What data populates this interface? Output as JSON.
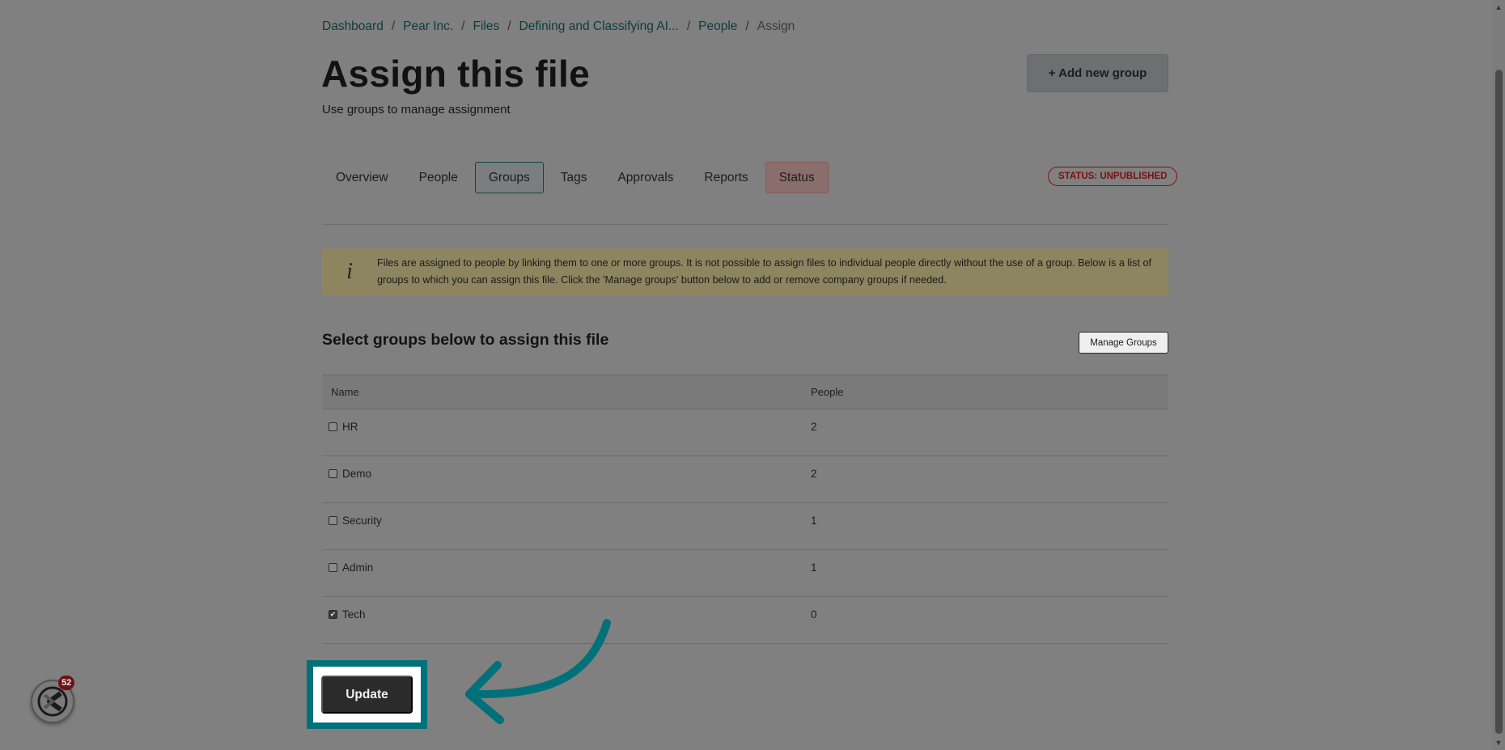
{
  "breadcrumb": [
    {
      "label": "Dashboard"
    },
    {
      "label": "Pear Inc."
    },
    {
      "label": "Files"
    },
    {
      "label": "Defining and Classifying AI..."
    },
    {
      "label": "People"
    }
  ],
  "breadcrumb_separator": "/",
  "breadcrumb_current": "Assign",
  "header": {
    "title": "Assign this file",
    "subtitle": "Use groups to manage assignment",
    "add_group_label": "+ Add new group"
  },
  "tabs": [
    {
      "label": "Overview"
    },
    {
      "label": "People"
    },
    {
      "label": "Groups"
    },
    {
      "label": "Tags"
    },
    {
      "label": "Approvals"
    },
    {
      "label": "Reports"
    },
    {
      "label": "Status"
    }
  ],
  "active_tab": "Groups",
  "status_badge": "STATUS: UNPUBLISHED",
  "info": {
    "icon": "info-icon",
    "line1": "Files are assigned to people by linking them to one or more groups. It is not possible to assign files to individual people directly without the use of a group. Below is a list of",
    "line2": "groups to which you can assign this file. Click the 'Manage groups' button below to add or remove company groups if needed."
  },
  "groups_section": {
    "title": "Select groups below to assign this file",
    "manage_label": "Manage Groups",
    "columns": {
      "name": "Name",
      "people": "People"
    },
    "rows": [
      {
        "name": "HR",
        "people": "2",
        "checked": false
      },
      {
        "name": "Demo",
        "people": "2",
        "checked": false
      },
      {
        "name": "Security",
        "people": "1",
        "checked": false
      },
      {
        "name": "Admin",
        "people": "1",
        "checked": false
      },
      {
        "name": "Tech",
        "people": "0",
        "checked": true
      }
    ]
  },
  "update_label": "Update",
  "chat": {
    "badge_count": "52"
  },
  "colors": {
    "highlight": "#00717a",
    "accent_text": "#0d3b3c"
  }
}
